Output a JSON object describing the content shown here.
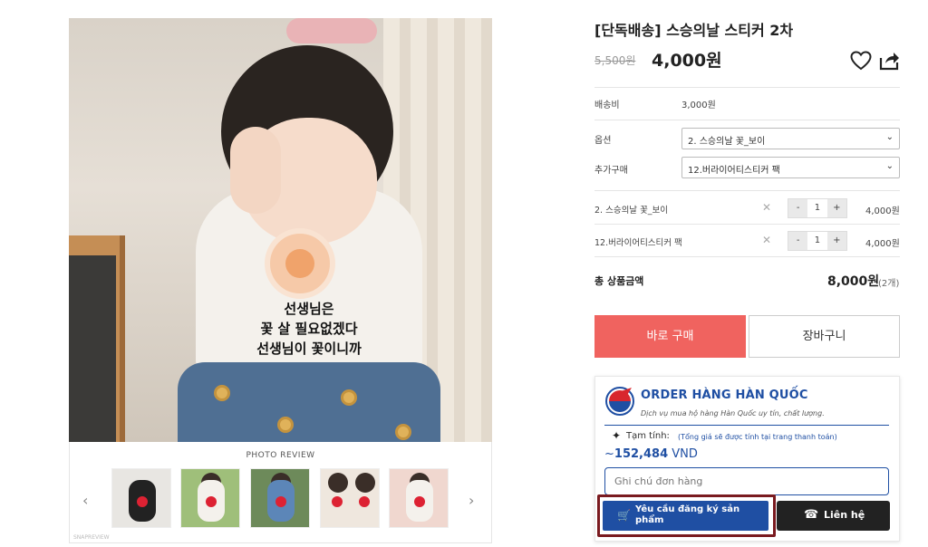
{
  "product": {
    "title": "[단독배송] 스승의날 스티커 2차",
    "old_price": "5,500원",
    "new_price": "4,000원",
    "shirt_text_lines": [
      "선생님은",
      "꽃 살 필요없겠다",
      "선생님이 꽃이니까"
    ]
  },
  "review": {
    "title": "PHOTO REVIEW",
    "prev_arrow": "‹",
    "next_arrow": "›",
    "watermark": "SNAPREVIEW"
  },
  "info": {
    "shipping_label": "배송비",
    "shipping_value": "3,000원",
    "option_label": "옵션",
    "option_value": "2. 스승의날 꽃_보이",
    "addon_label": "추가구매",
    "addon_value": "12.버라이어티스티커 팩",
    "chevron": "⌄"
  },
  "line_items": [
    {
      "name": "2. 스승의날 꽃_보이",
      "minus": "-",
      "qty": "1",
      "plus": "+",
      "price": "4,000원"
    },
    {
      "name": "12.버라이어티스티커 팩",
      "minus": "-",
      "qty": "1",
      "plus": "+",
      "price": "4,000원"
    }
  ],
  "total": {
    "label": "총 상품금액",
    "value": "8,000원",
    "count": "(2개)"
  },
  "buttons": {
    "buy": "바로 구매",
    "cart": "장바구니"
  },
  "order_widget": {
    "brand": "ORDER HÀNG HÀN QUỐC",
    "tagline": "Dịch vụ mua hộ hàng Hàn Quốc uy tín, chất lượng.",
    "est_label": "Tạm tính:",
    "est_note": "(Tổng giá sẽ được tính tại trang thanh toán)",
    "est_prefix": "~",
    "est_amount": "152,484",
    "est_currency": "VND",
    "note_placeholder": "Ghi chú đơn hàng",
    "request_label": "Yêu cầu đăng ký sản phẩm",
    "contact_label": "Liên hệ"
  },
  "colors": {
    "buy_red": "#f0635f",
    "brand_blue": "#1f4fa3",
    "highlight_maroon": "#7a1a1f"
  },
  "icons": [
    "heart-icon",
    "share-icon",
    "close-icon",
    "cart-icon",
    "phone-icon",
    "sparkle-icon",
    "chevron-down-icon"
  ]
}
